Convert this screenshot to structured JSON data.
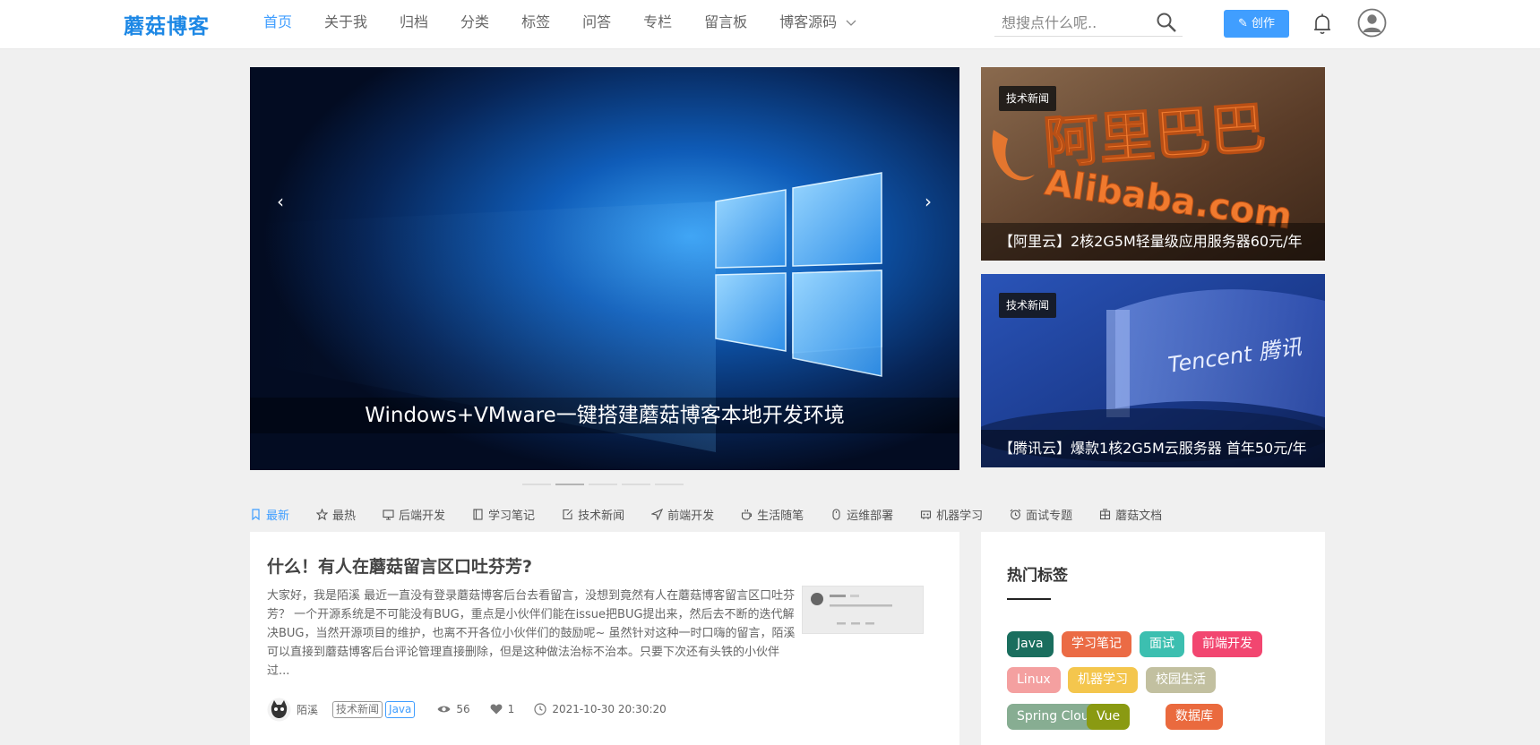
{
  "header": {
    "logo": "蘑菇博客",
    "nav": [
      {
        "label": "首页",
        "active": true
      },
      {
        "label": "关于我"
      },
      {
        "label": "归档"
      },
      {
        "label": "分类"
      },
      {
        "label": "标签"
      },
      {
        "label": "问答"
      },
      {
        "label": "专栏"
      },
      {
        "label": "留言板"
      },
      {
        "label": "博客源码",
        "dropdown": true
      }
    ],
    "search_placeholder": "想搜点什么呢..",
    "create_label": "创作"
  },
  "carousel": {
    "caption": "Windows+VMware一键搭建蘑菇博客本地开发环境",
    "prev": "‹",
    "next": "›",
    "slide_count": 5,
    "active_index": 1
  },
  "side_cards": [
    {
      "badge": "技术新闻",
      "caption": "【阿里云】2核2G5M轻量级应用服务器60元/年",
      "logo_text": "阿里巴巴",
      "logo_subtext": "Alibaba.com"
    },
    {
      "badge": "技术新闻",
      "caption": "【腾讯云】爆款1核2G5M云服务器 首年50元/年",
      "logo_text": "Tencent 腾讯"
    }
  ],
  "category_tabs": [
    {
      "label": "最新",
      "icon": "bookmark-icon",
      "active": true
    },
    {
      "label": "最热",
      "icon": "star-icon"
    },
    {
      "label": "后端开发",
      "icon": "monitor-icon"
    },
    {
      "label": "学习笔记",
      "icon": "notebook-icon"
    },
    {
      "label": "技术新闻",
      "icon": "edit-icon"
    },
    {
      "label": "前端开发",
      "icon": "send-icon"
    },
    {
      "label": "生活随笔",
      "icon": "coffee-icon"
    },
    {
      "label": "运维部署",
      "icon": "mouse-icon"
    },
    {
      "label": "机器学习",
      "icon": "robot-icon"
    },
    {
      "label": "面试专题",
      "icon": "alarm-icon"
    },
    {
      "label": "蘑菇文档",
      "icon": "grid-icon"
    }
  ],
  "article": {
    "title": "什么！有人在蘑菇留言区口吐芬芳?",
    "summary": "大家好，我是陌溪 最近一直没有登录蘑菇博客后台去看留言，没想到竟然有人在蘑菇博客留言区口吐芬芳？ 一个开源系统是不可能没有BUG，重点是小伙伴们能在issue把BUG提出来，然后去不断的迭代解决BUG，当然开源项目的维护，也离不开各位小伙伴们的鼓励呢~ 虽然针对这种一时口嗨的留言，陌溪可以直接到蘑菇博客后台评论管理直接删除，但是这种做法治标不治本。只要下次还有头铁的小伙伴过...",
    "author": "陌溪",
    "tags": [
      "技术新闻",
      "Java"
    ],
    "views": "56",
    "likes": "1",
    "date": "2021-10-30 20:30:20"
  },
  "hot_tags": {
    "title": "热门标签",
    "tags": [
      {
        "label": "Java",
        "color": "#1a6e5e"
      },
      {
        "label": "学习笔记",
        "color": "#eb6b45"
      },
      {
        "label": "面试",
        "color": "#3cbfb0"
      },
      {
        "label": "前端开发",
        "color": "#f24670"
      },
      {
        "label": "Linux",
        "color": "#f4a0a0"
      },
      {
        "label": "机器学习",
        "color": "#f4c64d"
      },
      {
        "label": "校园生活",
        "color": "#c2c0a0"
      },
      {
        "label": "Spring Cloud",
        "color": "#87ad92"
      },
      {
        "label": "Vue",
        "color": "#8a9a12"
      },
      {
        "label": "数据库",
        "color": "#ea6a3e"
      }
    ]
  }
}
